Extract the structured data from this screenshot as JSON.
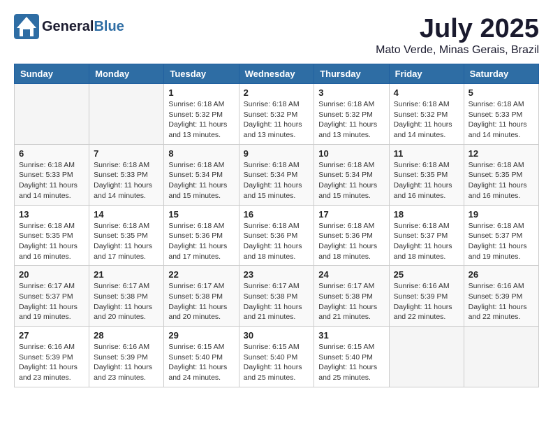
{
  "header": {
    "logo_general": "General",
    "logo_blue": "Blue",
    "month": "July 2025",
    "location": "Mato Verde, Minas Gerais, Brazil"
  },
  "weekdays": [
    "Sunday",
    "Monday",
    "Tuesday",
    "Wednesday",
    "Thursday",
    "Friday",
    "Saturday"
  ],
  "weeks": [
    [
      {
        "day": "",
        "info": ""
      },
      {
        "day": "",
        "info": ""
      },
      {
        "day": "1",
        "info": "Sunrise: 6:18 AM\nSunset: 5:32 PM\nDaylight: 11 hours and 13 minutes."
      },
      {
        "day": "2",
        "info": "Sunrise: 6:18 AM\nSunset: 5:32 PM\nDaylight: 11 hours and 13 minutes."
      },
      {
        "day": "3",
        "info": "Sunrise: 6:18 AM\nSunset: 5:32 PM\nDaylight: 11 hours and 13 minutes."
      },
      {
        "day": "4",
        "info": "Sunrise: 6:18 AM\nSunset: 5:32 PM\nDaylight: 11 hours and 14 minutes."
      },
      {
        "day": "5",
        "info": "Sunrise: 6:18 AM\nSunset: 5:33 PM\nDaylight: 11 hours and 14 minutes."
      }
    ],
    [
      {
        "day": "6",
        "info": "Sunrise: 6:18 AM\nSunset: 5:33 PM\nDaylight: 11 hours and 14 minutes."
      },
      {
        "day": "7",
        "info": "Sunrise: 6:18 AM\nSunset: 5:33 PM\nDaylight: 11 hours and 14 minutes."
      },
      {
        "day": "8",
        "info": "Sunrise: 6:18 AM\nSunset: 5:34 PM\nDaylight: 11 hours and 15 minutes."
      },
      {
        "day": "9",
        "info": "Sunrise: 6:18 AM\nSunset: 5:34 PM\nDaylight: 11 hours and 15 minutes."
      },
      {
        "day": "10",
        "info": "Sunrise: 6:18 AM\nSunset: 5:34 PM\nDaylight: 11 hours and 15 minutes."
      },
      {
        "day": "11",
        "info": "Sunrise: 6:18 AM\nSunset: 5:35 PM\nDaylight: 11 hours and 16 minutes."
      },
      {
        "day": "12",
        "info": "Sunrise: 6:18 AM\nSunset: 5:35 PM\nDaylight: 11 hours and 16 minutes."
      }
    ],
    [
      {
        "day": "13",
        "info": "Sunrise: 6:18 AM\nSunset: 5:35 PM\nDaylight: 11 hours and 16 minutes."
      },
      {
        "day": "14",
        "info": "Sunrise: 6:18 AM\nSunset: 5:35 PM\nDaylight: 11 hours and 17 minutes."
      },
      {
        "day": "15",
        "info": "Sunrise: 6:18 AM\nSunset: 5:36 PM\nDaylight: 11 hours and 17 minutes."
      },
      {
        "day": "16",
        "info": "Sunrise: 6:18 AM\nSunset: 5:36 PM\nDaylight: 11 hours and 18 minutes."
      },
      {
        "day": "17",
        "info": "Sunrise: 6:18 AM\nSunset: 5:36 PM\nDaylight: 11 hours and 18 minutes."
      },
      {
        "day": "18",
        "info": "Sunrise: 6:18 AM\nSunset: 5:37 PM\nDaylight: 11 hours and 18 minutes."
      },
      {
        "day": "19",
        "info": "Sunrise: 6:18 AM\nSunset: 5:37 PM\nDaylight: 11 hours and 19 minutes."
      }
    ],
    [
      {
        "day": "20",
        "info": "Sunrise: 6:17 AM\nSunset: 5:37 PM\nDaylight: 11 hours and 19 minutes."
      },
      {
        "day": "21",
        "info": "Sunrise: 6:17 AM\nSunset: 5:38 PM\nDaylight: 11 hours and 20 minutes."
      },
      {
        "day": "22",
        "info": "Sunrise: 6:17 AM\nSunset: 5:38 PM\nDaylight: 11 hours and 20 minutes."
      },
      {
        "day": "23",
        "info": "Sunrise: 6:17 AM\nSunset: 5:38 PM\nDaylight: 11 hours and 21 minutes."
      },
      {
        "day": "24",
        "info": "Sunrise: 6:17 AM\nSunset: 5:38 PM\nDaylight: 11 hours and 21 minutes."
      },
      {
        "day": "25",
        "info": "Sunrise: 6:16 AM\nSunset: 5:39 PM\nDaylight: 11 hours and 22 minutes."
      },
      {
        "day": "26",
        "info": "Sunrise: 6:16 AM\nSunset: 5:39 PM\nDaylight: 11 hours and 22 minutes."
      }
    ],
    [
      {
        "day": "27",
        "info": "Sunrise: 6:16 AM\nSunset: 5:39 PM\nDaylight: 11 hours and 23 minutes."
      },
      {
        "day": "28",
        "info": "Sunrise: 6:16 AM\nSunset: 5:39 PM\nDaylight: 11 hours and 23 minutes."
      },
      {
        "day": "29",
        "info": "Sunrise: 6:15 AM\nSunset: 5:40 PM\nDaylight: 11 hours and 24 minutes."
      },
      {
        "day": "30",
        "info": "Sunrise: 6:15 AM\nSunset: 5:40 PM\nDaylight: 11 hours and 25 minutes."
      },
      {
        "day": "31",
        "info": "Sunrise: 6:15 AM\nSunset: 5:40 PM\nDaylight: 11 hours and 25 minutes."
      },
      {
        "day": "",
        "info": ""
      },
      {
        "day": "",
        "info": ""
      }
    ]
  ]
}
